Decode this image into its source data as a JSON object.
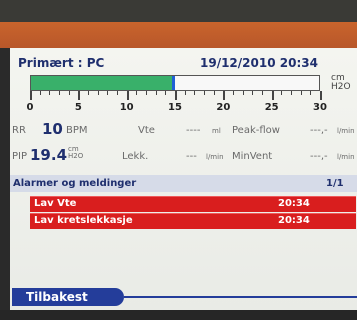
{
  "header": {
    "mode": "Primært : PC",
    "datetime": "19/12/2010 20:34"
  },
  "gauge": {
    "unit_top": "cm",
    "unit_bottom": "H2O",
    "ticks": [
      "0",
      "5",
      "10",
      "15",
      "20",
      "25",
      "30"
    ],
    "min": 0,
    "max": 30,
    "value": 15
  },
  "readings": {
    "rr_label": "RR",
    "rr_value": "10",
    "rr_unit": "BPM",
    "vte_label": "Vte",
    "vte_value": "----",
    "vte_unit": "ml",
    "peakflow_label": "Peak-flow",
    "peakflow_value": "---,-",
    "peakflow_unit": "l/min",
    "pip_label": "PIP",
    "pip_value": "19.4",
    "pip_unit_top": "cm",
    "pip_unit_bottom": "H2O",
    "lekk_label": "Lekk.",
    "lekk_value": "---",
    "lekk_unit": "l/min",
    "minvent_label": "MinVent",
    "minvent_value": "---,-",
    "minvent_unit": "l/min"
  },
  "alarms": {
    "title": "Alarmer og meldinger",
    "page": "1/1",
    "items": [
      {
        "label": "Lav Vte",
        "time": "20:34"
      },
      {
        "label": "Lav kretslekkasje",
        "time": "20:34"
      }
    ]
  },
  "footer": {
    "back_label": "Tilbakest"
  },
  "colors": {
    "accent": "#243d9a",
    "alarm": "#d91e1e",
    "bar": "#39b06a",
    "header_band": "#c9642c"
  }
}
